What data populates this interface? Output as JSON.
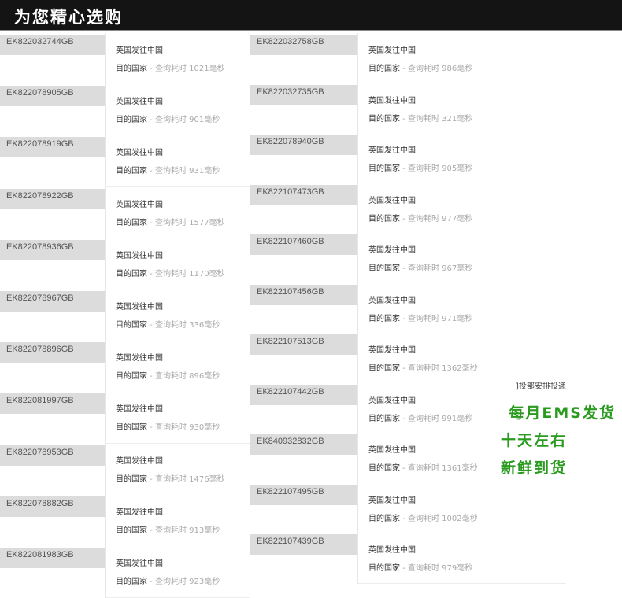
{
  "header": {
    "title": "为您精心选购"
  },
  "record_labels": {
    "route": "英国发往中国",
    "dest": "目的国家",
    "sep": " - ",
    "query": "查询耗时 ",
    "unit": "毫秒"
  },
  "left_column": [
    {
      "tracking": "EK822032744GB",
      "ms": "1021"
    },
    {
      "tracking": "EK822078905GB",
      "ms": "901"
    },
    {
      "tracking": "EK822078919GB",
      "ms": "931"
    },
    {
      "tracking": "EK822078922GB",
      "ms": "1577"
    },
    {
      "tracking": "EK822078936GB",
      "ms": "1170"
    },
    {
      "tracking": "EK822078967GB",
      "ms": "336"
    },
    {
      "tracking": "EK822078896GB",
      "ms": "896"
    },
    {
      "tracking": "EK822081997GB",
      "ms": "930"
    },
    {
      "tracking": "EK822078953GB",
      "ms": "1476"
    },
    {
      "tracking": "EK822078882GB",
      "ms": "913"
    },
    {
      "tracking": "EK822081983GB",
      "ms": "923"
    }
  ],
  "right_column": [
    {
      "tracking": "EK822032758GB",
      "ms": "986"
    },
    {
      "tracking": "EK822032735GB",
      "ms": "321"
    },
    {
      "tracking": "EK822078940GB",
      "ms": "905"
    },
    {
      "tracking": "EK822107473GB",
      "ms": "977"
    },
    {
      "tracking": "EK822107460GB",
      "ms": "967"
    },
    {
      "tracking": "EK822107456GB",
      "ms": "971"
    },
    {
      "tracking": "EK822107513GB",
      "ms": "1362"
    },
    {
      "tracking": "EK822107442GB",
      "ms": "991"
    },
    {
      "tracking": "EK840932832GB",
      "ms": "1361"
    },
    {
      "tracking": "EK822107495GB",
      "ms": "1002"
    },
    {
      "tracking": "EK822107439GB",
      "ms": "979"
    }
  ],
  "side_note": "]投部安排投递",
  "promo": {
    "line1": "每月EMS发货",
    "line2": "十天左右",
    "line3": "新鲜到货"
  },
  "colors": {
    "promo": "#2a9b1f",
    "header_bg": "#141414",
    "tracking_bg": "#dcdcdc"
  }
}
